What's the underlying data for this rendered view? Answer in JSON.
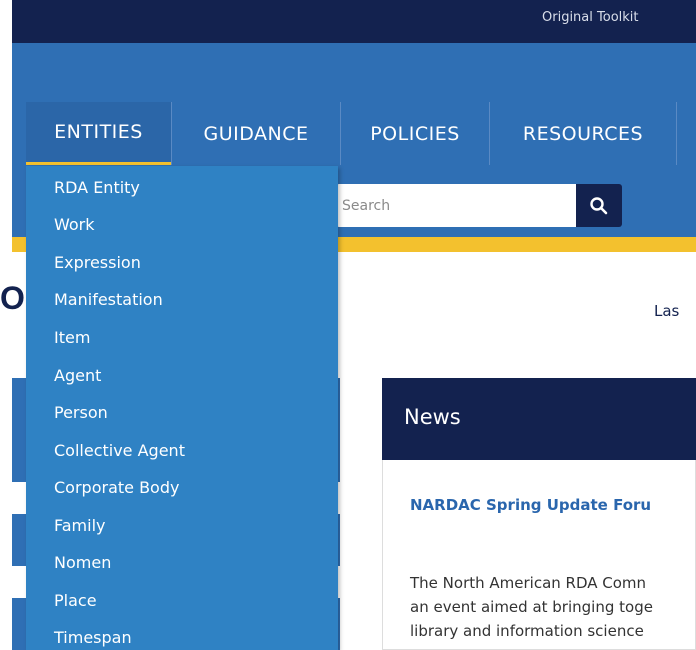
{
  "top_bar": {
    "original_toolkit": "Original Toolkit"
  },
  "nav": {
    "tabs": [
      "ENTITIES",
      "GUIDANCE",
      "POLICIES",
      "RESOURCES"
    ]
  },
  "search": {
    "placeholder": "Search"
  },
  "page": {
    "heading_fragment": "O",
    "last_updated_fragment": "Las"
  },
  "dropdown": {
    "items": [
      "RDA Entity",
      "Work",
      "Expression",
      "Manifestation",
      "Item",
      "Agent",
      "Person",
      "Collective Agent",
      "Corporate Body",
      "Family",
      "Nomen",
      "Place",
      "Timespan"
    ]
  },
  "news": {
    "title": "News",
    "headline": "NARDAC Spring Update Foru",
    "body_lines": [
      "The North American RDA Comn",
      "an event aimed at bringing toge",
      "library and information science"
    ]
  },
  "colors": {
    "navy": "#13224f",
    "blue": "#2f6fb4",
    "yellow": "#f3c12e",
    "dropdown": "#2f82c4"
  }
}
